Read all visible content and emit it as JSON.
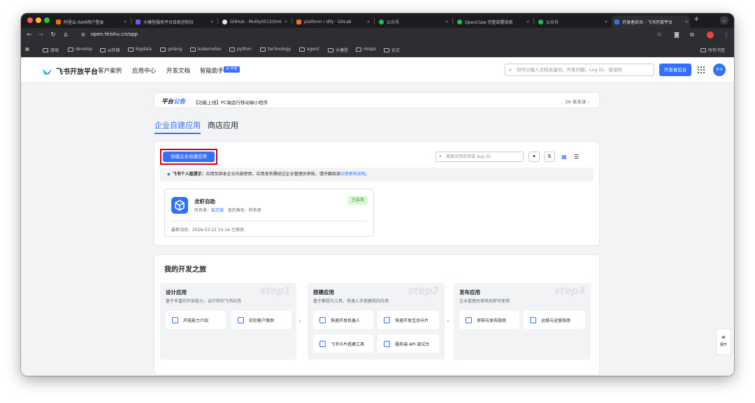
{
  "browser": {
    "tabs": [
      {
        "label": "阿里云-RAM用户登录"
      },
      {
        "label": "大模型服务平台百炼控制台"
      },
      {
        "label": "GitHub - Mullly0513/Omi"
      },
      {
        "label": "platform / dify · GitLab"
      },
      {
        "label": "公众号"
      },
      {
        "label": "OpenClaw 完整部署指南"
      },
      {
        "label": "公众号"
      },
      {
        "label": "开发者后台 - 飞书开放平台"
      }
    ],
    "url": "open.feishu.cn/app",
    "bookmarks": [
      "游戏",
      "develop",
      "ai存储",
      "bigdata",
      "golang",
      "kubernetes",
      "python",
      "technology",
      "agent",
      "大模型",
      "mlops",
      "论文"
    ],
    "all_bookmarks": "所有书签"
  },
  "header": {
    "brand": "飞书开放平台",
    "nav": [
      "客户案例",
      "应用中心",
      "开发文档",
      "智能助手"
    ],
    "ai_badge": "AI 开发",
    "search_placeholder": "你可以输入文档关键词、开发问题、Log ID、错误码",
    "dev_console": "开发者后台",
    "avatar": "炎炎"
  },
  "notice": {
    "title_a": "平台",
    "title_b": "公告",
    "text": "【功能上线】PC端运行移动端小程序",
    "unread": "26 条未读 ›"
  },
  "tabs": {
    "enterprise": "企业自建应用",
    "store": "商店应用"
  },
  "apps": {
    "create_button": "创建企业自建应用",
    "search_placeholder": "搜索应用名称或 App ID",
    "tip_bold": "飞书个人版提示：",
    "tip_text": "应用仅供本企业内部使用，应用发布需经过企业管理员审核，请仔细阅读",
    "tip_link": "应用审核说明",
    "tip_end": "。",
    "card": {
      "name": "龙虾自助",
      "status": "已启用",
      "owner_label": "所有者：",
      "owner": "柴志斌",
      "role_label": "· 我的角色：所有者",
      "updated": "最新动态：2026-03-12 15:16 已修改"
    }
  },
  "journey": {
    "title": "我的开发之旅",
    "steps": [
      {
        "title": "设计应用",
        "desc": "基于丰富的开放能力，设计你的飞书应用",
        "wm": "step1",
        "buttons": [
          "开放能力介绍",
          "实际客户案例"
        ]
      },
      {
        "title": "搭建应用",
        "desc": "基于教程与工具，快速上手搭建我的应用",
        "wm": "step2",
        "buttons": [
          "快速开发机器人",
          "快速开发互动卡片",
          "飞书卡片搭建工具",
          "服务端 API 调试台"
        ]
      },
      {
        "title": "发布应用",
        "desc": "企业管理员审核后即可使用",
        "wm": "step3",
        "buttons": [
          "审核与发布指南",
          "运维与运营指南"
        ]
      }
    ]
  },
  "expand": {
    "arrows": "«",
    "label": "展开"
  },
  "colors": {
    "primary": "#3370ff",
    "highlight": "#d0021b",
    "success": "#34c724"
  }
}
